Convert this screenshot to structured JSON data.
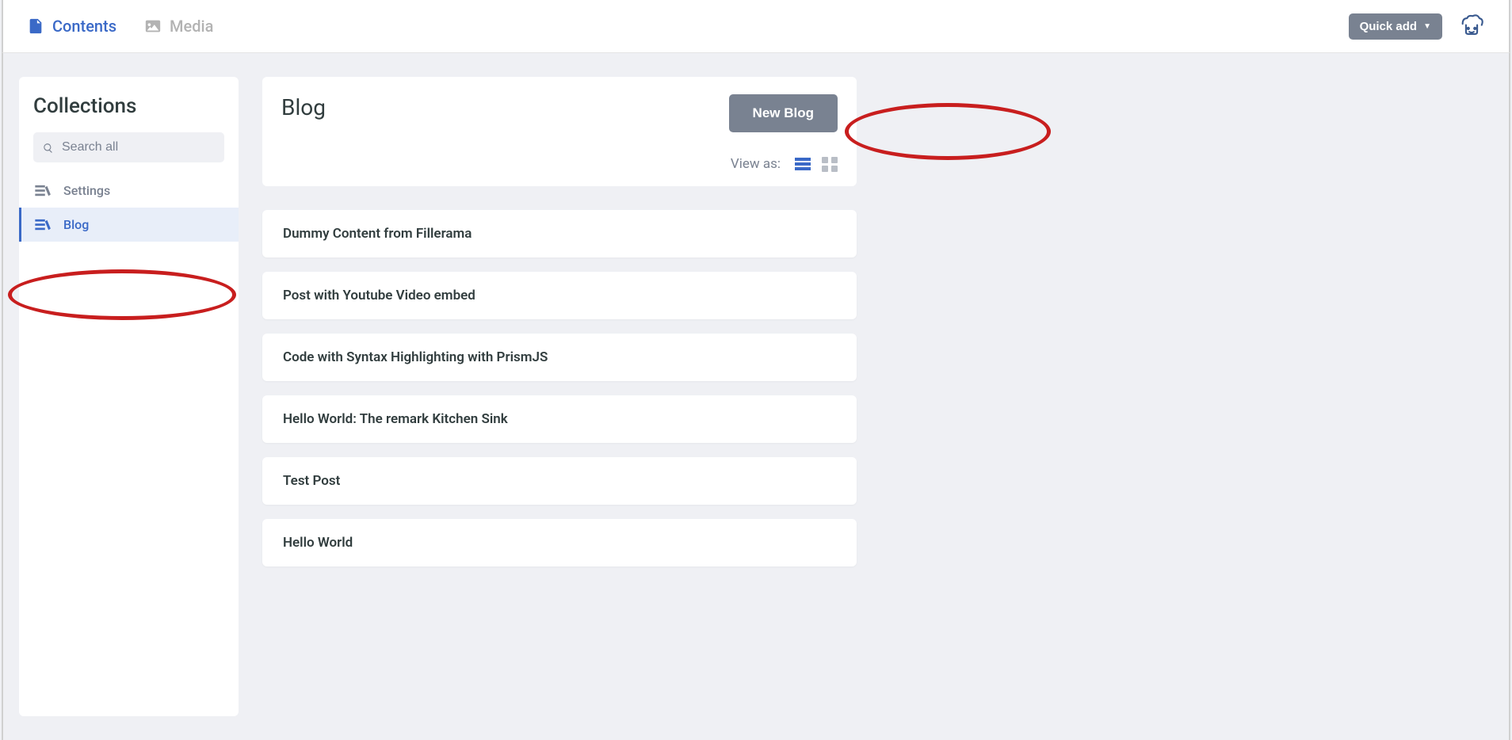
{
  "nav": {
    "contents": "Contents",
    "media": "Media",
    "quick_add": "Quick add"
  },
  "sidebar": {
    "title": "Collections",
    "search_placeholder": "Search all",
    "items": [
      {
        "label": "Settings"
      },
      {
        "label": "Blog"
      }
    ]
  },
  "main": {
    "title": "Blog",
    "new_button": "New Blog",
    "view_as": "View as:",
    "entries": [
      {
        "title": "Dummy Content from Fillerama"
      },
      {
        "title": "Post with Youtube Video embed"
      },
      {
        "title": "Code with Syntax Highlighting with PrismJS"
      },
      {
        "title": "Hello World: The remark Kitchen Sink"
      },
      {
        "title": "Test Post"
      },
      {
        "title": "Hello World"
      }
    ]
  }
}
